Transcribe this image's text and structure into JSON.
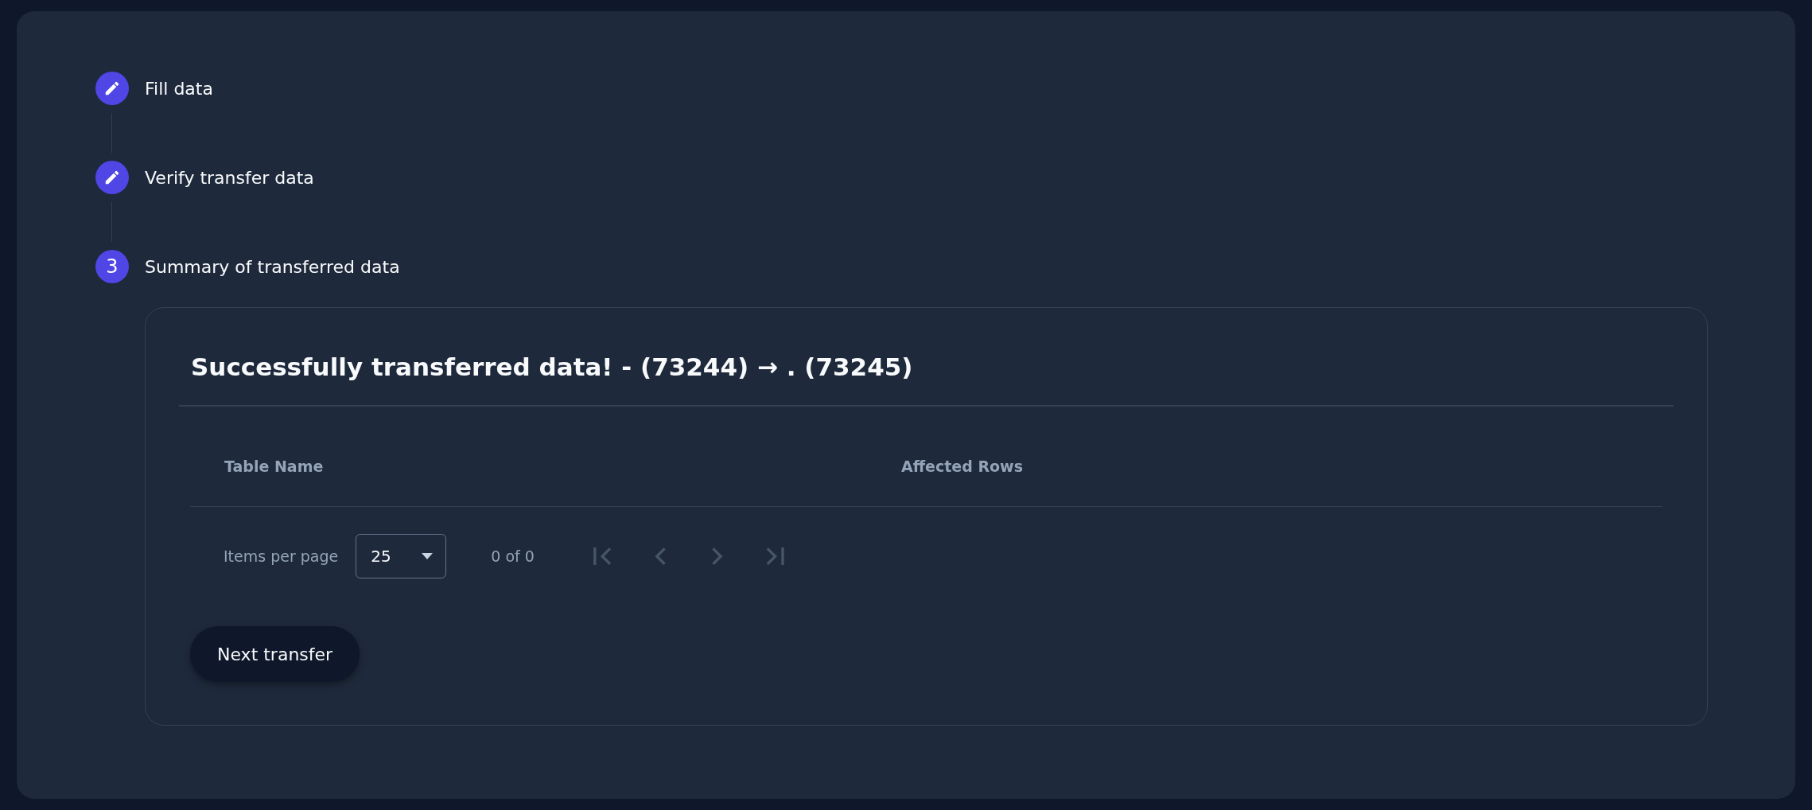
{
  "stepper": {
    "steps": [
      {
        "kind": "edit",
        "label": "Fill data"
      },
      {
        "kind": "edit",
        "label": "Verify transfer data"
      },
      {
        "kind": "number",
        "number": "3",
        "label": "Summary of transferred data"
      }
    ]
  },
  "summary": {
    "title": "Successfully transferred data! - (73244) → . (73245)",
    "table": {
      "columns": [
        "Table Name",
        "Affected Rows"
      ]
    },
    "pagination": {
      "items_per_page_label": "Items per page",
      "page_size": "25",
      "range": "0 of 0",
      "buttons": [
        {
          "kind": "first",
          "disabled": true
        },
        {
          "kind": "prev",
          "disabled": true
        },
        {
          "kind": "next",
          "disabled": true
        },
        {
          "kind": "last",
          "disabled": true
        }
      ]
    },
    "action": "Next transfer"
  }
}
